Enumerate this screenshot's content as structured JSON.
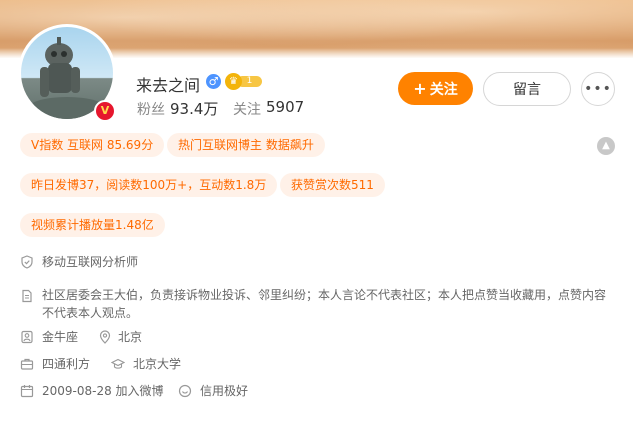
{
  "profile": {
    "name": "来去之间",
    "gender_symbol": "♂",
    "level": "1",
    "verified_symbol": "V",
    "followers_label": "粉丝",
    "followers_value": "93.4万",
    "following_label": "关注",
    "following_value": "5907"
  },
  "actions": {
    "follow_plus": "+",
    "follow_label": "关注",
    "message_label": "留言",
    "more_label": "•••"
  },
  "tags": [
    "V指数 互联网 85.69分",
    "热门互联网博主 数据飙升",
    "昨日发博37，阅读数100万+，互动数1.8万",
    "获赞赏次数511",
    "视频累计播放量1.48亿"
  ],
  "info": {
    "title": "移动互联网分析师",
    "bio": "社区居委会王大伯，负责接诉物业投诉、邻里纠纷；本人言论不代表社区；本人把点赞当收藏用，点赞内容不代表本人观点。",
    "zodiac": "金牛座",
    "location": "北京",
    "company": "四通利方",
    "school": "北京大学",
    "joined": "2009-08-28 加入微博",
    "credit": "信用极好"
  },
  "colors": {
    "accent": "#ff8200",
    "tag_bg": "#fff1e8",
    "tag_text": "#ff6a00",
    "verified_badge": "#e6162d",
    "gender": "#4d94ff"
  },
  "icons": [
    "shield-icon",
    "document-icon",
    "user-icon",
    "location-icon",
    "briefcase-icon",
    "graduation-cap-icon",
    "calendar-icon",
    "credit-icon",
    "chevron-up-icon",
    "more-icon"
  ]
}
